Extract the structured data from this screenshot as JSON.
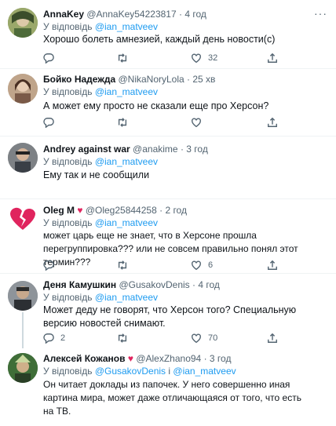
{
  "reply_prefix": "У відповідь",
  "tweets": [
    {
      "name": "AnnaKey",
      "handle": "@AnnaKey54223817",
      "time": "4 год",
      "reply_to": "@ian_matveev",
      "text": "Хорошо болеть амнезией, каждый день новости(с)",
      "comments": "",
      "retweets": "",
      "likes": "32"
    },
    {
      "name": "Бойко Надежда",
      "handle": "@NikaNoryLola",
      "time": "25 хв",
      "reply_to": "@ian_matveev",
      "text": "А может ему просто не сказали еще про Херсон?",
      "comments": "",
      "retweets": "",
      "likes": ""
    },
    {
      "name": "Andrey against war",
      "handle": "@anakime",
      "time": "3 год",
      "reply_to": "@ian_matveev",
      "text": "Ему так и не сообщили",
      "comments": "",
      "retweets": "",
      "likes": ""
    },
    {
      "name": "Oleg M",
      "handle": "@Oleg25844258",
      "time": "2 год",
      "reply_to": "@ian_matveev",
      "text": "может царь еще не знает, что в Херсоне прошла перегруппировка??? или не совсем правильно понял этот термин???",
      "comments": "",
      "retweets": "",
      "likes": "6"
    },
    {
      "name": "Деня Камушкин",
      "handle": "@GusakovDenis",
      "time": "4 год",
      "reply_to": "@ian_matveev",
      "text": "Может деду не говорят, что Херсон того? Специальную версию новостей снимают.",
      "comments": "2",
      "retweets": "",
      "likes": "70"
    },
    {
      "name": "Алексей Кожанов",
      "handle": "@AlexZhano94",
      "time": "3 год",
      "reply_to": "@GusakovDenis",
      "reply_join": "і",
      "reply_to_2": "@ian_matveev",
      "text": "Он читает доклады из папочек. У него совершенно иная картина мира, может даже отличающаяся от того, что есть на ТВ.",
      "comments": "",
      "retweets": "",
      "likes": ""
    }
  ],
  "colors": {
    "accent": "#1d9bf0",
    "secondary_text": "#536471",
    "divider": "#eff3f4",
    "heart_red": "#e0245e"
  }
}
